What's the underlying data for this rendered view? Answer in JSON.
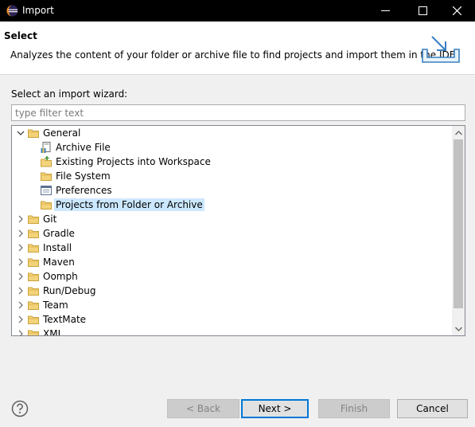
{
  "window": {
    "title": "Import",
    "icon": "eclipse-icon"
  },
  "banner": {
    "heading": "Select",
    "description": "Analyzes the content of your folder or archive file to find projects and import them in the IDE."
  },
  "wizard": {
    "label": "Select an import wizard:",
    "filter_placeholder": "type filter text",
    "filter_value": ""
  },
  "tree": {
    "items": [
      {
        "label": "General",
        "icon": "folder-icon",
        "expanded": true,
        "level": 0
      },
      {
        "label": "Archive File",
        "icon": "archive-file-icon",
        "level": 1
      },
      {
        "label": "Existing Projects into Workspace",
        "icon": "existing-projects-icon",
        "level": 1
      },
      {
        "label": "File System",
        "icon": "folder-icon",
        "level": 1
      },
      {
        "label": "Preferences",
        "icon": "preferences-icon",
        "level": 1
      },
      {
        "label": "Projects from Folder or Archive",
        "icon": "folder-icon",
        "level": 1,
        "selected": true
      },
      {
        "label": "Git",
        "icon": "folder-icon",
        "expanded": false,
        "level": 0
      },
      {
        "label": "Gradle",
        "icon": "folder-icon",
        "expanded": false,
        "level": 0
      },
      {
        "label": "Install",
        "icon": "folder-icon",
        "expanded": false,
        "level": 0
      },
      {
        "label": "Maven",
        "icon": "folder-icon",
        "expanded": false,
        "level": 0
      },
      {
        "label": "Oomph",
        "icon": "folder-icon",
        "expanded": false,
        "level": 0
      },
      {
        "label": "Run/Debug",
        "icon": "folder-icon",
        "expanded": false,
        "level": 0
      },
      {
        "label": "Team",
        "icon": "folder-icon",
        "expanded": false,
        "level": 0
      },
      {
        "label": "TextMate",
        "icon": "folder-icon",
        "expanded": false,
        "level": 0
      },
      {
        "label": "XML",
        "icon": "folder-icon",
        "expanded": false,
        "level": 0
      }
    ]
  },
  "buttons": {
    "back": "< Back",
    "next": "Next >",
    "finish": "Finish",
    "cancel": "Cancel"
  },
  "colors": {
    "selection": "#cce8ff",
    "folder": "#e8c463",
    "accent": "#0078d7"
  }
}
